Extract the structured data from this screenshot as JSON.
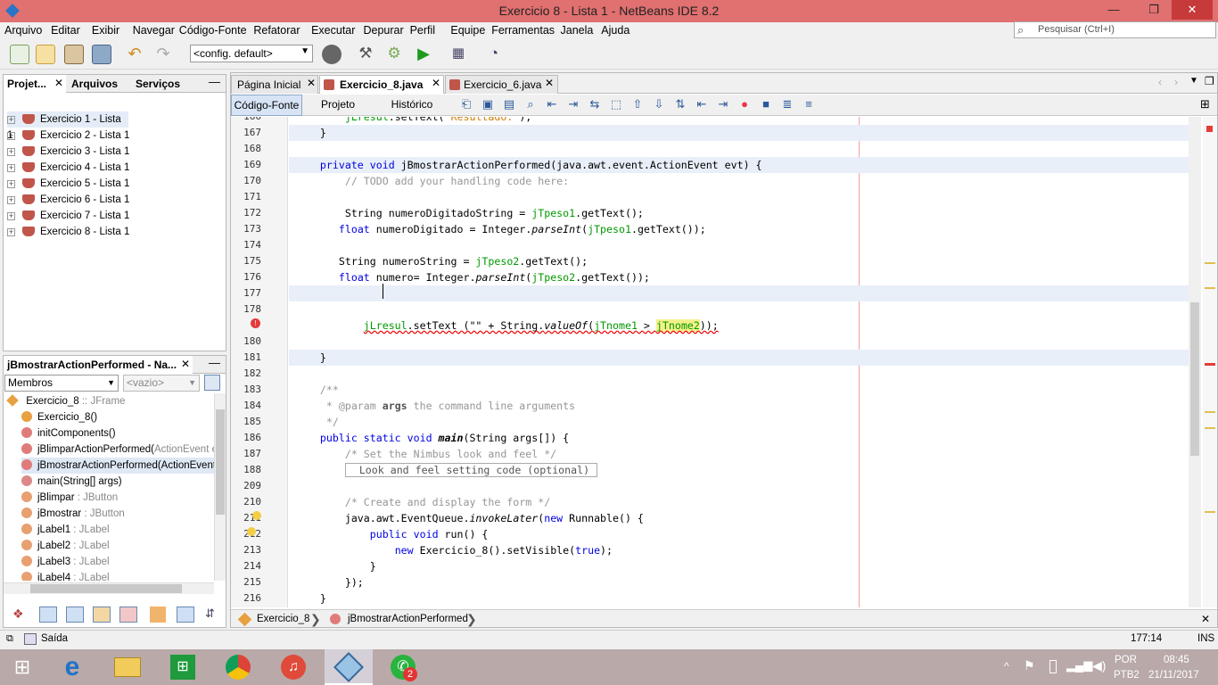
{
  "window": {
    "title": "Exercicio 8 - Lista 1 - NetBeans IDE 8.2",
    "min": "—",
    "max": "❐",
    "close": "✕"
  },
  "menu": [
    "Arquivo",
    "Editar",
    "Exibir",
    "Navegar",
    "Código-Fonte",
    "Refatorar",
    "Executar",
    "Depurar",
    "Perfil",
    "Equipe",
    "Ferramentas",
    "Janela",
    "Ajuda"
  ],
  "search_placeholder": "Pesquisar (Ctrl+I)",
  "config": "<config. default>",
  "projects_panel": {
    "tabs": [
      "Projet...",
      "Arquivos",
      "Serviços"
    ],
    "items": [
      "Exercicio 1 - Lista 1",
      "Exercicio 2 - Lista 1",
      "Exercicio 3 - Lista 1",
      "Exercicio 4 - Lista 1",
      "Exercicio 5 - Lista 1",
      "Exercicio 6 - Lista 1",
      "Exercicio 7 - Lista 1",
      "Exercicio 8 - Lista 1"
    ]
  },
  "navigator": {
    "title": "jBmostrarActionPerformed - Na...",
    "filter": "Membros",
    "filter2": "<vazio>",
    "root": "Exercicio_8",
    "root_type": ":: JFrame",
    "members": [
      {
        "name": "Exercicio_8()",
        "type": ""
      },
      {
        "name": "initComponents()",
        "type": ""
      },
      {
        "name": "jBlimparActionPerformed(",
        "type": "ActionEvent e"
      },
      {
        "name": "jBmostrarActionPerformed(ActionEvent",
        "type": ""
      },
      {
        "name": "main(String[] args)",
        "type": ""
      },
      {
        "name": "jBlimpar",
        "type": " : JButton"
      },
      {
        "name": "jBmostrar",
        "type": " : JButton"
      },
      {
        "name": "jLabel1",
        "type": " : JLabel"
      },
      {
        "name": "jLabel2",
        "type": " : JLabel"
      },
      {
        "name": "jLabel3",
        "type": " : JLabel"
      },
      {
        "name": "jLabel4",
        "type": " : JLabel"
      }
    ]
  },
  "editor": {
    "tabs": [
      "Página Inicial",
      "Exercicio_8.java",
      "Exercicio_6.java"
    ],
    "subtabs": [
      "Código-Fonte",
      "Projeto",
      "Histórico"
    ],
    "breadcrumb": [
      "Exercicio_8",
      "jBmostrarActionPerformed"
    ]
  },
  "code_lines": [
    {
      "n": "166",
      "html": "        <span class=\"fld\">jLresul</span>.setText(<span style=\"color:#ce7b00\">\"Resultado:\"</span>);"
    },
    {
      "n": "167",
      "html": "    }",
      "hl": true
    },
    {
      "n": "168",
      "html": ""
    },
    {
      "n": "169",
      "html": "    <span class=\"kw\">private void</span> jBmostrarActionPerformed(java.awt.event.ActionEvent evt) {",
      "hl": true
    },
    {
      "n": "170",
      "html": "        <span class=\"cm\">// TODO add your handling code here:</span>"
    },
    {
      "n": "171",
      "html": ""
    },
    {
      "n": "172",
      "html": "        String numeroDigitadoString = <span class=\"fld\">jTpeso1</span>.getText();"
    },
    {
      "n": "173",
      "html": "       <span class=\"kw\">float</span> numeroDigitado = Integer.<span class=\"it\">parseInt</span>(<span class=\"fld\">jTpeso1</span>.getText());"
    },
    {
      "n": "174",
      "html": ""
    },
    {
      "n": "175",
      "html": "       String numeroString = <span class=\"fld\">jTpeso2</span>.getText();"
    },
    {
      "n": "176",
      "html": "       <span class=\"kw\">float</span> numero= Integer.<span class=\"it\">parseInt</span>(<span class=\"fld\">jTpeso2</span>.getText());"
    },
    {
      "n": "177",
      "html": "             ",
      "hl": true
    },
    {
      "n": "178",
      "html": ""
    },
    {
      "n": "",
      "html": "           <span class=\"squig\"><span class=\"fld\">jLresul</span>.setText (\"\" + String.<span class=\"it\">valueOf</span>(<span class=\"fld\">jTnome1</span> &gt; <span class=\"fld\" style=\"background:#f4f08a\">jTnome2</span>));</span>"
    },
    {
      "n": "180",
      "html": ""
    },
    {
      "n": "181",
      "html": "    }",
      "hl": true
    },
    {
      "n": "182",
      "html": ""
    },
    {
      "n": "183",
      "html": "    <span class=\"cm\">/**</span>"
    },
    {
      "n": "184",
      "html": "     <span class=\"cm\">* @param <b style=\"color:#555\">args</b> the command line arguments</span>"
    },
    {
      "n": "185",
      "html": "     <span class=\"cm\">*/</span>"
    },
    {
      "n": "186",
      "html": "    <span class=\"kw\">public static void</span> <b class=\"it\">main</b>(String args[]) {"
    },
    {
      "n": "187",
      "html": "        <span class=\"cm\">/* Set the Nimbus look and feel */</span>"
    },
    {
      "n": "188",
      "html": "        <span style=\"border:1px solid #aaa;color:#555;padding:0 8px\"> Look and feel setting code (optional)</span>"
    },
    {
      "n": "209",
      "html": ""
    },
    {
      "n": "210",
      "html": "        <span class=\"cm\">/* Create and display the form */</span>"
    },
    {
      "n": "211",
      "html": "        java.awt.EventQueue.<span class=\"it\">invokeLater</span>(<span class=\"kw\">new</span> Runnable() {"
    },
    {
      "n": "212",
      "html": "            <span class=\"kw\">public void</span> run() {"
    },
    {
      "n": "213",
      "html": "                <span class=\"kw\">new</span> Exercicio_8().setVisible(<span class=\"kw\">true</span>);"
    },
    {
      "n": "214",
      "html": "            }"
    },
    {
      "n": "215",
      "html": "        });"
    },
    {
      "n": "216",
      "html": "    }"
    }
  ],
  "status": {
    "output": "Saída",
    "pos": "177:14",
    "mode": "INS"
  },
  "tray": {
    "lang": "POR",
    "layout": "PTB2",
    "time": "08:45",
    "date": "21/11/2017",
    "badge": "2"
  }
}
